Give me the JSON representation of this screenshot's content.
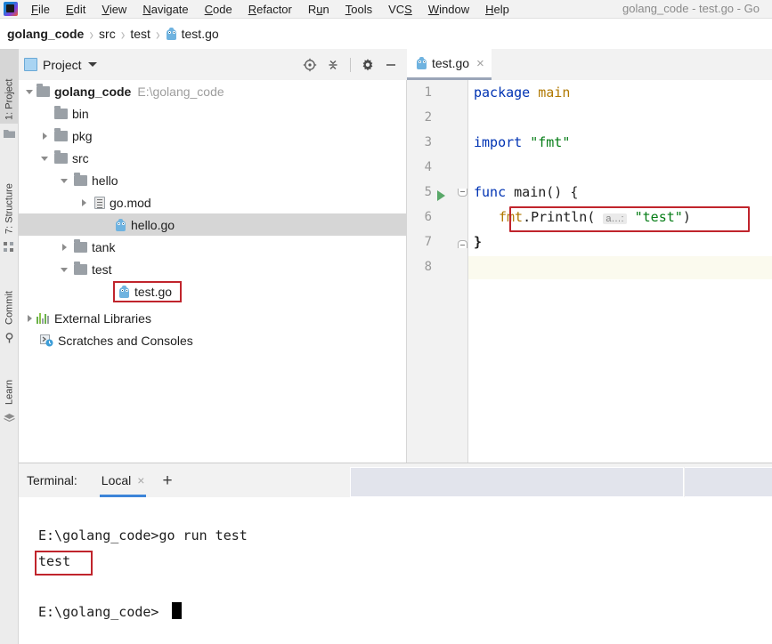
{
  "window": {
    "title": "golang_code - test.go - Go",
    "logo_icon": "goland-logo-icon"
  },
  "menubar": {
    "items": [
      {
        "label": "File",
        "mnemonic": "F"
      },
      {
        "label": "Edit",
        "mnemonic": "E"
      },
      {
        "label": "View",
        "mnemonic": "V"
      },
      {
        "label": "Navigate",
        "mnemonic": "N"
      },
      {
        "label": "Code",
        "mnemonic": "C"
      },
      {
        "label": "Refactor",
        "mnemonic": "R"
      },
      {
        "label": "Run",
        "mnemonic": "u"
      },
      {
        "label": "Tools",
        "mnemonic": "T"
      },
      {
        "label": "VCS",
        "mnemonic": "S"
      },
      {
        "label": "Window",
        "mnemonic": "W"
      },
      {
        "label": "Help",
        "mnemonic": "H"
      }
    ]
  },
  "breadcrumb": {
    "items": [
      "golang_code",
      "src",
      "test",
      "test.go"
    ],
    "separator": "›",
    "file_icon": "go-file-icon"
  },
  "stripe": {
    "tabs": [
      {
        "label": "1: Project",
        "icon": "project-icon",
        "active": true
      },
      {
        "label": "7: Structure",
        "icon": "structure-icon",
        "active": false
      },
      {
        "label": "Commit",
        "icon": "commit-icon",
        "active": false
      },
      {
        "label": "Learn",
        "icon": "learn-icon",
        "active": false
      }
    ]
  },
  "project_tool": {
    "title": "Project",
    "title_icon": "project-window-icon",
    "actions": [
      {
        "name": "select-opened-file-icon",
        "label": "locate"
      },
      {
        "name": "collapse-all-icon",
        "label": "collapse all"
      },
      {
        "name": "gear-icon",
        "label": "settings"
      },
      {
        "name": "minimize-icon",
        "label": "hide"
      }
    ],
    "tree": [
      {
        "label": "golang_code",
        "path": "E:\\golang_code",
        "icon": "folder-icon",
        "indent": 0,
        "toggle": "down",
        "bold": true,
        "selected": false,
        "highlighted": false
      },
      {
        "label": "bin",
        "path": "",
        "icon": "folder-icon",
        "indent": 1,
        "toggle": "none",
        "bold": false,
        "selected": false,
        "highlighted": false
      },
      {
        "label": "pkg",
        "path": "",
        "icon": "folder-icon",
        "indent": 1,
        "toggle": "right",
        "bold": false,
        "selected": false,
        "highlighted": false
      },
      {
        "label": "src",
        "path": "",
        "icon": "folder-icon",
        "indent": 1,
        "toggle": "down",
        "bold": false,
        "selected": false,
        "highlighted": false
      },
      {
        "label": "hello",
        "path": "",
        "icon": "folder-icon",
        "indent": 2,
        "toggle": "down",
        "bold": false,
        "selected": false,
        "highlighted": false
      },
      {
        "label": "go.mod",
        "path": "",
        "icon": "go-mod-icon",
        "indent": 3,
        "toggle": "right",
        "bold": false,
        "selected": false,
        "highlighted": false
      },
      {
        "label": "hello.go",
        "path": "",
        "icon": "go-file-icon",
        "indent": 3,
        "toggle": "none",
        "bold": false,
        "selected": true,
        "highlighted": false
      },
      {
        "label": "tank",
        "path": "",
        "icon": "folder-icon",
        "indent": 2,
        "toggle": "right",
        "bold": false,
        "selected": false,
        "highlighted": false
      },
      {
        "label": "test",
        "path": "",
        "icon": "folder-icon",
        "indent": 2,
        "toggle": "down",
        "bold": false,
        "selected": false,
        "highlighted": false
      },
      {
        "label": "test.go",
        "path": "",
        "icon": "go-file-icon",
        "indent": 3,
        "toggle": "none",
        "bold": false,
        "selected": false,
        "highlighted": true
      },
      {
        "label": "External Libraries",
        "path": "",
        "icon": "libraries-icon",
        "indent": 0,
        "toggle": "right",
        "bold": false,
        "selected": false,
        "highlighted": false
      },
      {
        "label": "Scratches and Consoles",
        "path": "",
        "icon": "scratches-icon",
        "indent": 0,
        "toggle": "none",
        "bold": false,
        "selected": false,
        "highlighted": false
      }
    ]
  },
  "editor": {
    "tab": {
      "label": "test.go",
      "icon": "go-file-icon",
      "close": "×"
    },
    "lines": [
      {
        "n": "1",
        "text": "package main"
      },
      {
        "n": "2",
        "text": ""
      },
      {
        "n": "3",
        "text": "import \"fmt\""
      },
      {
        "n": "4",
        "text": ""
      },
      {
        "n": "5",
        "text": "func main() {"
      },
      {
        "n": "6",
        "text": "fmt.Println( a…: \"test\")"
      },
      {
        "n": "7",
        "text": "}"
      },
      {
        "n": "8",
        "text": ""
      }
    ],
    "tokens": {
      "kw_package": "package",
      "kw_main": "main",
      "kw_import": "import",
      "str_fmt": "\"fmt\"",
      "kw_func": "func",
      "fn_main": "main",
      "parens_empty": "() {",
      "pkg_fmt": "fmt",
      "dot": ".",
      "fn_println": "Println",
      "open_paren": "(",
      "inlay_hint": "a…:",
      "str_test": "\"test\"",
      "close_paren": ")",
      "brace_close": "}"
    },
    "run_marker": "run-gutter-icon",
    "caret_line": "8"
  },
  "terminal": {
    "label": "Terminal:",
    "tab": {
      "label": "Local",
      "close": "×"
    },
    "add": "+",
    "lines": [
      {
        "text": "E:\\golang_code>go run test",
        "highlight": false
      },
      {
        "text": "test",
        "highlight": true
      },
      {
        "text": "",
        "highlight": false
      },
      {
        "text": "E:\\golang_code>",
        "highlight": false
      }
    ]
  },
  "colors": {
    "annotation_red": "#c0242c",
    "keyword_blue": "#0033b3",
    "string_green": "#067d17",
    "package_gold": "#b07800",
    "tab_underline": "#3c84d8",
    "run_green": "#59a869",
    "selection_grey": "#d6d6d6",
    "caret_row": "#fbfaee"
  }
}
